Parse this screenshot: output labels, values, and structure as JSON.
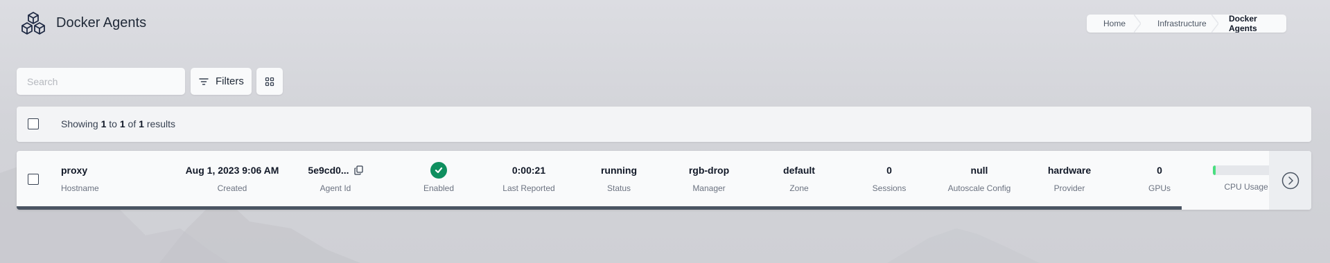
{
  "header": {
    "title": "Docker Agents",
    "icon": "cubes-icon"
  },
  "breadcrumb": {
    "items": [
      "Home",
      "Infrastructure",
      "Docker Agents"
    ]
  },
  "toolbar": {
    "search_placeholder": "Search",
    "search_value": "",
    "filters_label": "Filters",
    "filters_icon": "filter-lines-icon",
    "grid_icon": "grid-view-icon"
  },
  "results": {
    "prefix": "Showing",
    "from": "1",
    "to_word": "to",
    "to": "1",
    "of_word": "of",
    "total": "1",
    "suffix": "results"
  },
  "agents": [
    {
      "hostname": "proxy",
      "hostname_label": "Hostname",
      "created": "Aug 1, 2023 9:06 AM",
      "created_label": "Created",
      "agent_id": "5e9cd0...",
      "agent_id_label": "Agent Id",
      "enabled_label": "Enabled",
      "last_reported": "0:00:21",
      "last_reported_label": "Last Reported",
      "status": "running",
      "status_label": "Status",
      "manager": "rgb-drop",
      "manager_label": "Manager",
      "zone": "default",
      "zone_label": "Zone",
      "sessions": "0",
      "sessions_label": "Sessions",
      "autoscale_config": "null",
      "autoscale_config_label": "Autoscale Config",
      "provider": "hardware",
      "provider_label": "Provider",
      "gpus": "0",
      "gpus_label": "GPUs",
      "cpu_usage_label": "CPU Usage",
      "cpu_usage_fraction": 0.05,
      "row_progress_fraction": 0.9
    }
  ],
  "colors": {
    "enabled_green": "#0f8f5f",
    "cpu_fill": "#4ade80",
    "progress": "#4b5563"
  }
}
